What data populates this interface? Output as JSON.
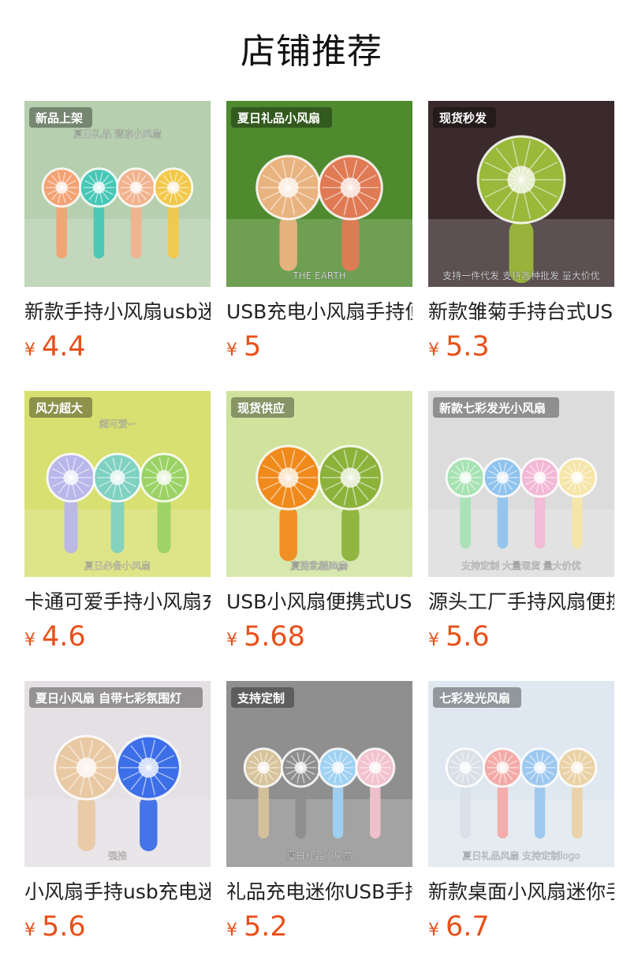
{
  "page": {
    "title": "店铺推荐"
  },
  "products": [
    {
      "name": "新款手持小风扇usb迷你",
      "currency": "¥",
      "price": "4.4",
      "overlay_texts": [
        "新品上架",
        "夏日礼品 清凉小风扇"
      ],
      "colors": {
        "bg": "#b6cfae",
        "fans": [
          "#f3a273",
          "#45c7b6",
          "#f1b28d",
          "#f2c84a"
        ]
      }
    },
    {
      "name": "USB充电小风扇手持便携",
      "currency": "¥",
      "price": "5",
      "overlay_texts": [
        "夏日礼品小风扇",
        "THE EARTH"
      ],
      "colors": {
        "bg": "#4f8a2e",
        "fans": [
          "#e9b380",
          "#e07a55"
        ]
      }
    },
    {
      "name": "新款雏菊手持台式USB",
      "currency": "¥",
      "price": "5.3",
      "overlay_texts": [
        "现货秒发",
        "支持一件代发 支持各种批发 量大价优"
      ],
      "colors": {
        "bg": "#3a2a2c",
        "fans": [
          "#9ab83a"
        ]
      }
    },
    {
      "name": "卡通可爱手持小风扇充电",
      "currency": "¥",
      "price": "4.6",
      "overlay_texts": [
        "风力超大",
        "超可爱~",
        "夏日必备小风扇"
      ],
      "colors": {
        "bg": "#d7e070",
        "fans": [
          "#b8b6ea",
          "#7fd1c2",
          "#9ad263"
        ]
      }
    },
    {
      "name": "USB小风扇便携式USB充电",
      "currency": "¥",
      "price": "5.68",
      "overlay_texts": [
        "现货供应",
        "支持定制logo",
        "夏日礼品风扇"
      ],
      "colors": {
        "bg": "#cfe39d",
        "fans": [
          "#f08a1c",
          "#8cb23a"
        ]
      }
    },
    {
      "name": "源头工厂手持风扇便携式",
      "currency": "¥",
      "price": "5.6",
      "overlay_texts": [
        "新款七彩发光小风扇",
        "支持定制 大量现货 量大价优"
      ],
      "colors": {
        "bg": "#dcdcdc",
        "fans": [
          "#a7e2b2",
          "#8fc3ee",
          "#f2b8d6",
          "#f5e5a8"
        ]
      }
    },
    {
      "name": "小风扇手持usb充电迷你",
      "currency": "¥",
      "price": "5.6",
      "overlay_texts": [
        "夏日小风扇 自带七彩氛围灯",
        "强推"
      ],
      "colors": {
        "bg": "#e5e0e3",
        "fans": [
          "#e9c9a4",
          "#3c6ee8"
        ]
      }
    },
    {
      "name": "礼品充电迷你USB手持风扇",
      "currency": "¥",
      "price": "5.2",
      "overlay_texts": [
        "支持定制",
        "夏日礼品小风扇"
      ],
      "colors": {
        "bg": "#8f8f8f",
        "fans": [
          "#d7c39c",
          "#8e8e8e",
          "#9fd1f2",
          "#f2c2cf"
        ]
      }
    },
    {
      "name": "新款桌面小风扇迷你手持",
      "currency": "¥",
      "price": "6.7",
      "overlay_texts": [
        "七彩发光风扇",
        "夏日礼品风扇 支持定制logo"
      ],
      "colors": {
        "bg": "#dfe8f0",
        "fans": [
          "#d9dfe6",
          "#f3aaa7",
          "#9cc7ef",
          "#ead2a6"
        ]
      }
    }
  ]
}
